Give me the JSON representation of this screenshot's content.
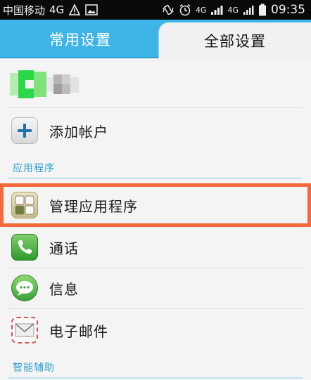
{
  "status_bar": {
    "carrier": "中国移动",
    "network": "4G",
    "net2": "4G",
    "net3": "4G",
    "time": "09:35"
  },
  "tabs": [
    {
      "label": "常用设置",
      "active": false
    },
    {
      "label": "全部设置",
      "active": true
    }
  ],
  "list": {
    "add_account": "添加帐户",
    "section_apps": "应用程序",
    "manage_apps": "管理应用程序",
    "phone": "通话",
    "messages": "信息",
    "email": "电子邮件",
    "section_accessibility": "智能辅助"
  },
  "colors": {
    "accent": "#3fb4e6",
    "highlight": "#f46a3c",
    "section": "#2a9fd4"
  }
}
